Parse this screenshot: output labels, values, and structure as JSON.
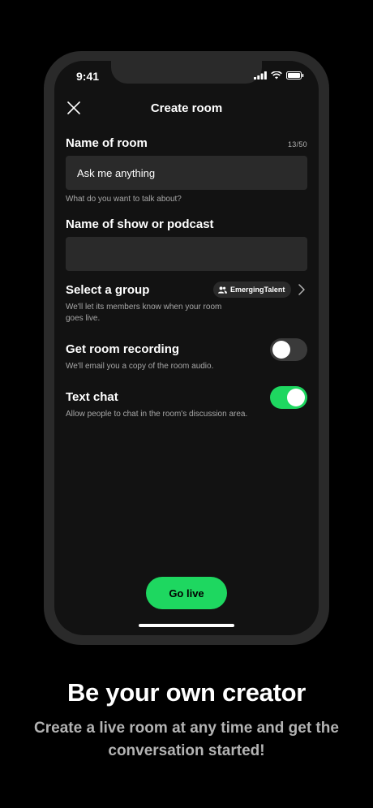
{
  "status_bar": {
    "time": "9:41",
    "icons": [
      "signal-icon",
      "wifi-icon",
      "battery-icon"
    ]
  },
  "header": {
    "title": "Create room",
    "close_icon": "close-icon"
  },
  "room_name": {
    "label": "Name of room",
    "counter": "13/50",
    "value": "Ask me anything",
    "helper": "What do you want to talk about?"
  },
  "show_name": {
    "label": "Name of show or podcast",
    "value": "",
    "placeholder": ""
  },
  "group": {
    "label": "Select a group",
    "description": "We'll let its members know when your room goes live.",
    "selected": "EmergingTalent",
    "chip_icon": "people-icon"
  },
  "recording": {
    "label": "Get room recording",
    "description": "We'll email you a copy of the room audio.",
    "enabled": false
  },
  "text_chat": {
    "label": "Text chat",
    "description": "Allow people to chat in the room's discussion area.",
    "enabled": true
  },
  "actions": {
    "go_live_label": "Go live"
  },
  "marketing": {
    "headline": "Be your own creator",
    "subline": "Create a live room at any time and get the conversation started!"
  },
  "colors": {
    "accent": "#1ed760",
    "background": "#121212",
    "field": "#2a2a2a"
  }
}
